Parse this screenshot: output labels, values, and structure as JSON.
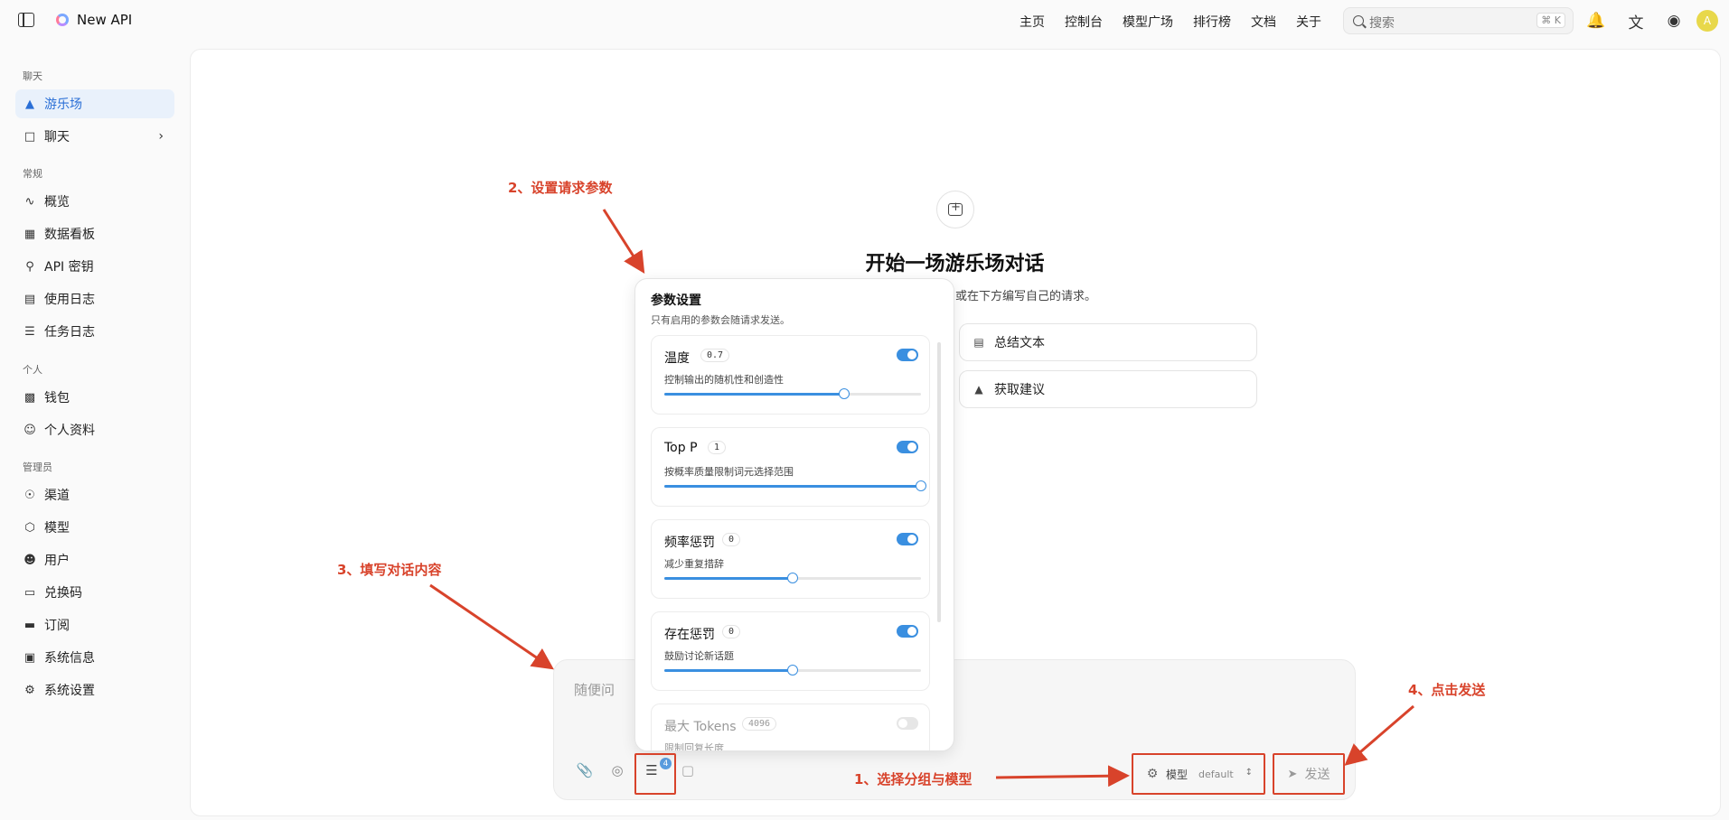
{
  "app": {
    "title": "New API"
  },
  "nav": {
    "items": [
      "主页",
      "控制台",
      "模型广场",
      "排行榜",
      "文档",
      "关于"
    ]
  },
  "search": {
    "placeholder": "搜索",
    "shortcut": "⌘ K"
  },
  "header_icons": [
    "bell-icon",
    "translate-icon",
    "palette-icon"
  ],
  "user": {
    "avatar_initial": "A"
  },
  "sidebar": {
    "section_chat": "聊天",
    "playground": "游乐场",
    "chat": "聊天",
    "section_general": "常规",
    "overview": "概览",
    "dashboard": "数据看板",
    "api_keys": "API 密钥",
    "usage_logs": "使用日志",
    "task_logs": "任务日志",
    "section_personal": "个人",
    "wallet": "钱包",
    "profile": "个人资料",
    "section_admin": "管理员",
    "channels": "渠道",
    "models": "模型",
    "users": "用户",
    "redeem": "兑换码",
    "subscriptions": "订阅",
    "system_info": "系统信息",
    "system_settings": "系统设置"
  },
  "main": {
    "headline": "开始一场游乐场对话",
    "subline": "或在下方编写自己的请求。",
    "suggestions": [
      "总结文本",
      "获取建议"
    ]
  },
  "composer": {
    "placeholder": "随便问",
    "params_badge": "4",
    "model_label": "模型",
    "model_value": "default",
    "send_label": "发送"
  },
  "params": {
    "title": "参数设置",
    "description": "只有启用的参数会随请求发送。",
    "items": [
      {
        "name": "温度",
        "value": "0.7",
        "hint": "控制输出的随机性和创造性",
        "enabled": true,
        "level": 0.7
      },
      {
        "name": "Top P",
        "value": "1",
        "hint": "按概率质量限制词元选择范围",
        "enabled": true,
        "level": 1.0
      },
      {
        "name": "频率惩罚",
        "value": "0",
        "hint": "减少重复措辞",
        "enabled": true,
        "level": 0.5
      },
      {
        "name": "存在惩罚",
        "value": "0",
        "hint": "鼓励讨论新话题",
        "enabled": true,
        "level": 0.5
      },
      {
        "name": "最大 Tokens",
        "value": "4096",
        "hint": "限制回复长度",
        "enabled": false,
        "level": 0
      }
    ]
  },
  "annotations": {
    "step1": "1、选择分组与模型",
    "step2": "2、设置请求参数",
    "step3": "3、填写对话内容",
    "step4": "4、点击发送"
  },
  "colors": {
    "accent": "#3a8fe0",
    "annotation": "#d8432b",
    "active_bg": "#e9f1fb"
  }
}
